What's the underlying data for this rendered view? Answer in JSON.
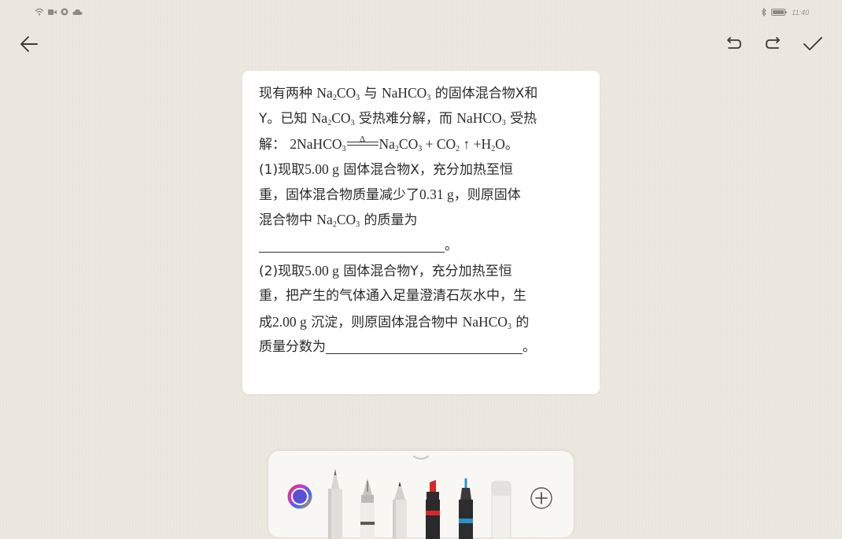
{
  "status_bar": {
    "time": "11:40",
    "left_icons": [
      "wifi-icon",
      "video-icon",
      "app-icon",
      "cloud-icon"
    ],
    "right_icons": [
      "bluetooth-icon",
      "battery-icon"
    ]
  },
  "toolbar": {
    "back": "back-arrow-icon",
    "undo": "undo-icon",
    "redo": "redo-icon",
    "done": "checkmark-icon"
  },
  "question": {
    "line1": {
      "a": "现有两种 ",
      "f1": "Na",
      "f1s": "2",
      "f1b": "CO",
      "f1bs": "3",
      "b": " 与 ",
      "f2": "NaHCO",
      "f2s": "3",
      "c": " 的固体混合物X和"
    },
    "line2": {
      "a": "Y。已知 ",
      "f1": "Na",
      "f1s": "2",
      "f1b": "CO",
      "f1bs": "3",
      "b": " 受热难分解，而 ",
      "f2": "NaHCO",
      "f2s": "3",
      "c": " 受热"
    },
    "line3": {
      "a": "解：",
      "r1": "2NaHCO",
      "r1s": "3",
      "delta": "Δ",
      "p1": "Na",
      "p1s": "2",
      "p1b": "CO",
      "p1bs": "3",
      "plus1": " + CO",
      "p2s": "2",
      "arrow": " ↑ ",
      "plus2": "+H",
      "p3s": "2",
      "p3b": "O",
      "end": "。"
    },
    "line4": {
      "a": "(1)现取",
      "num": "5.00 g",
      "b": " 固体混合物X，充分加热至恒"
    },
    "line5": {
      "a": "重，固体混合物质量减少了",
      "num": "0.31 g",
      "b": "，则原固体"
    },
    "line6": {
      "a": "混合物中 ",
      "f1": "Na",
      "f1s": "2",
      "f1b": "CO",
      "f1bs": "3",
      "b": " 的质量为"
    },
    "line7": {
      "end": "。"
    },
    "line8": {
      "a": "(2)现取",
      "num": "5.00 g",
      "b": " 固体混合物Y，充分加热至恒"
    },
    "line9": {
      "a": "重，把产生的气体通入足量澄清石灰水中，生"
    },
    "line10": {
      "a": "成",
      "num": "2.00 g",
      "b": " 沉淀，则原固体混合物中 ",
      "f1": "NaHCO",
      "f1s": "3",
      "c": " 的"
    },
    "line11": {
      "a": "质量分数为",
      "end": "。"
    }
  },
  "pen_tray": {
    "tools": [
      "color-picker",
      "pencil",
      "fountain-pen",
      "ballpoint-pen",
      "marker-red",
      "fineliner-blue",
      "eraser",
      "add-tool"
    ],
    "colors": {
      "marker": "#d9262c",
      "fineliner": "#2a90c8",
      "bg": "#ece7de"
    }
  }
}
